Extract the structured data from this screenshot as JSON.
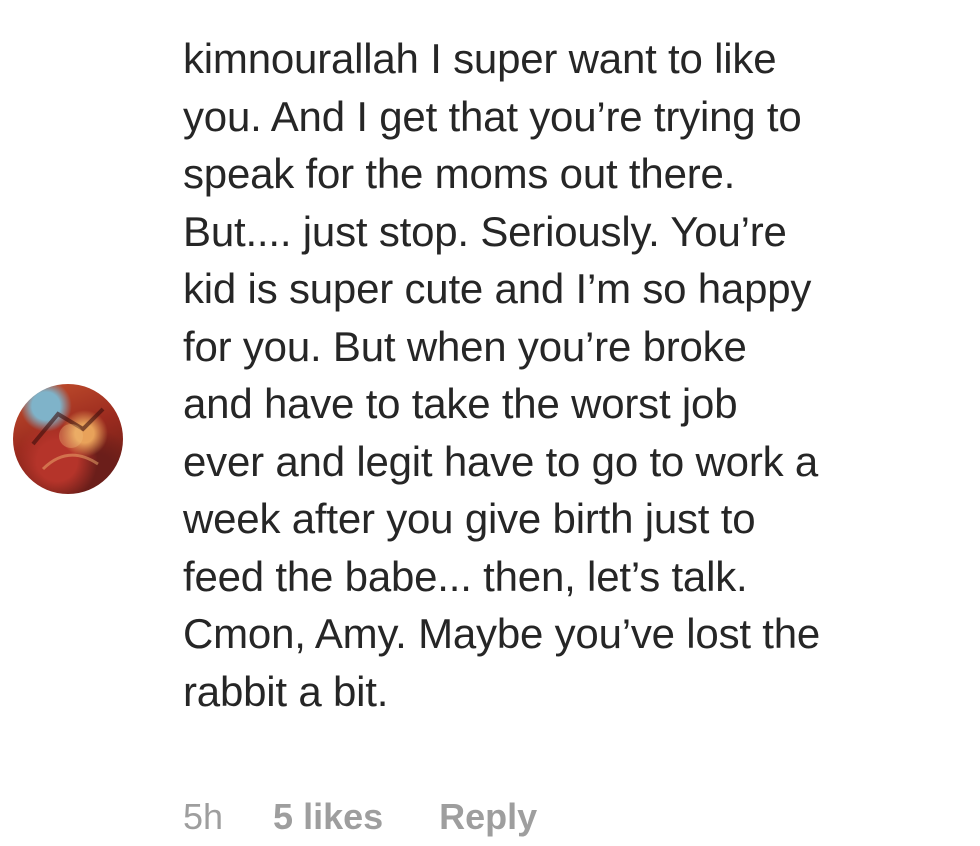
{
  "comment": {
    "username": "kimnourallah",
    "text": " I super want to like\nyou. And I get that you’re trying to\nspeak for the moms out there.\nBut.... just stop. Seriously. You’re\nkid is super cute and I’m so happy\nfor you. But when you’re broke\nand have to take the worst job\never and legit have to go to work a\nweek after you give birth just to\nfeed the babe... then, let’s talk.\nCmon, Amy. Maybe you’ve lost the\nrabbit a bit.",
    "time": "5h",
    "likes": "5 likes",
    "reply_label": "Reply"
  },
  "colors": {
    "text": "#262626",
    "meta": "#9e9e9e",
    "background": "#ffffff"
  },
  "icons": {
    "avatar": "user-avatar-photo"
  }
}
